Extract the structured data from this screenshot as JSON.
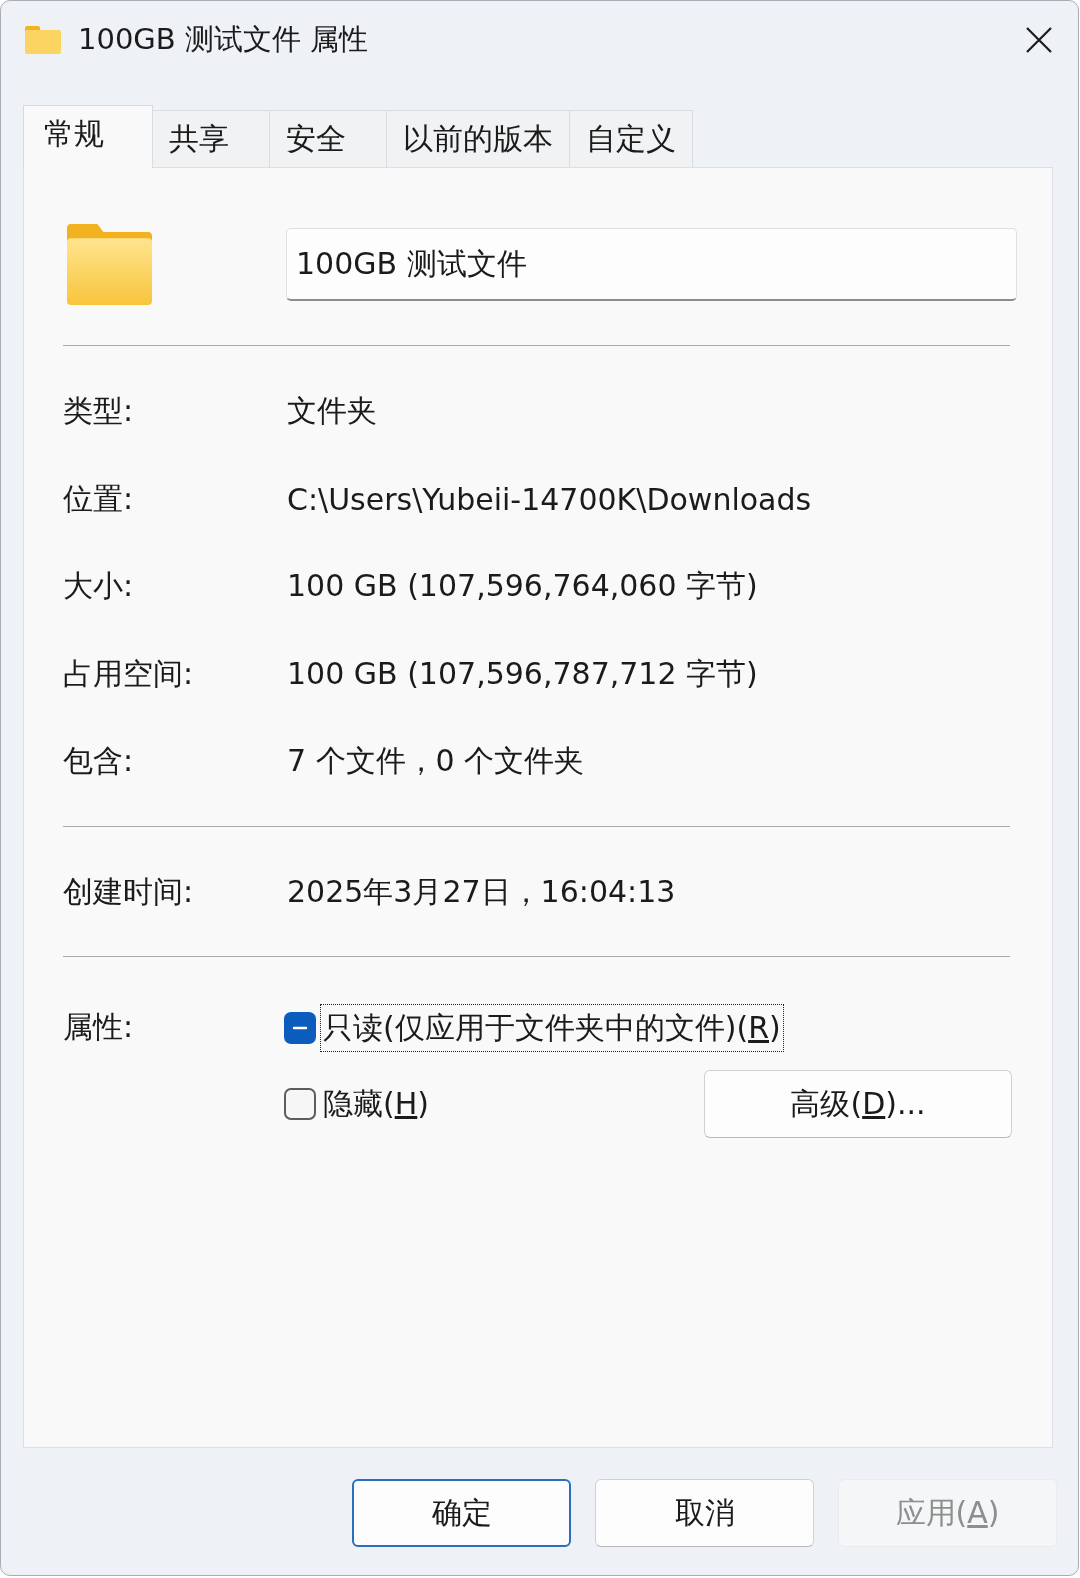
{
  "window": {
    "title": "100GB 测试文件 属性"
  },
  "tabs": [
    {
      "label": "常规",
      "selected": true
    },
    {
      "label": "共享",
      "selected": false
    },
    {
      "label": "安全",
      "selected": false
    },
    {
      "label": "以前的版本",
      "selected": false
    },
    {
      "label": "自定义",
      "selected": false
    }
  ],
  "name_field": {
    "value": "100GB 测试文件"
  },
  "sections": [
    {
      "rows": [
        {
          "label": "类型:",
          "value": "文件夹"
        },
        {
          "label": "位置:",
          "value": "C:\\Users\\Yubeii-14700K\\Downloads"
        },
        {
          "label": "大小:",
          "value": "100 GB (107,596,764,060 字节)"
        },
        {
          "label": "占用空间:",
          "value": "100 GB (107,596,787,712 字节)"
        },
        {
          "label": "包含:",
          "value": "7 个文件，0 个文件夹"
        }
      ]
    },
    {
      "rows": [
        {
          "label": "创建时间:",
          "value": "2025年3月27日，16:04:13"
        }
      ]
    }
  ],
  "attributes": {
    "label": "属性:",
    "options": [
      {
        "label": "只读(仅应用于文件夹中的文件)(",
        "access_key": "R",
        "label_end": ")",
        "checked": false,
        "indeterminate": true,
        "focused": true
      },
      {
        "label": "隐藏(",
        "access_key": "H",
        "label_end": ")",
        "checked": false,
        "indeterminate": false,
        "focused": false
      }
    ],
    "advanced_button": {
      "label": "高级(",
      "access_key": "D",
      "label_end": ")..."
    }
  },
  "footer_buttons": [
    {
      "label": "确定",
      "default": true,
      "disabled": false
    },
    {
      "label": "取消",
      "default": false,
      "disabled": false
    },
    {
      "label": "应用(",
      "access_key": "A",
      "label_end": ")",
      "default": false,
      "disabled": true
    }
  ]
}
